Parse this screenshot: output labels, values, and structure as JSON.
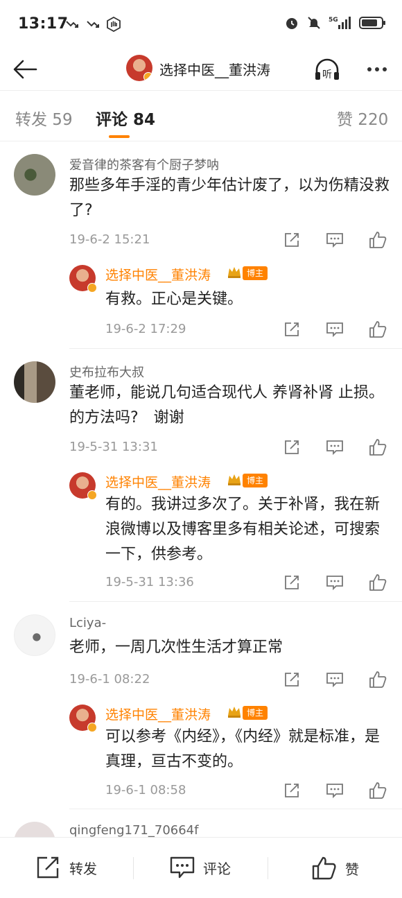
{
  "status": {
    "time": "13:17",
    "network": "5G"
  },
  "nav": {
    "title": "选择中医__董洪涛",
    "listen_label": "听"
  },
  "tabs": {
    "repost": "转发 59",
    "comment": "评论 84",
    "like": "赞 220"
  },
  "comments": [
    {
      "user": "爱音律的茶客有个厨子梦呐",
      "text": "那些多年手淫的青少年估计废了，以为伤精没救了?",
      "time": "19-6-2 15:21",
      "reply": {
        "user": "选择中医__董洪涛",
        "badge": "博主",
        "text": "有救。正心是关键。",
        "time": "19-6-2 17:29"
      }
    },
    {
      "user": "史布拉布大叔",
      "text": "董老师，能说几句适合现代人 养肾补肾 止损。的方法吗?　谢谢",
      "time": "19-5-31 13:31",
      "reply": {
        "user": "选择中医__董洪涛",
        "badge": "博主",
        "text": "有的。我讲过多次了。关于补肾，我在新浪微博以及博客里多有相关论述，可搜索一下，供参考。",
        "time": "19-5-31 13:36"
      }
    },
    {
      "user": "Lciya-",
      "text": "老师，一周几次性生活才算正常",
      "time": "19-6-1 08:22",
      "reply": {
        "user": "选择中医__董洪涛",
        "badge": "博主",
        "text": "可以参考《内经》，《内经》就是标准，是真理，亘古不变的。",
        "time": "19-6-1 08:58"
      }
    },
    {
      "user": "qingfeng171_70664f"
    }
  ],
  "bottom_bar": {
    "repost": "转发",
    "comment": "评论",
    "like": "赞"
  },
  "colors": {
    "accent": "#ff8200",
    "text": "#222222",
    "muted": "#999999"
  }
}
